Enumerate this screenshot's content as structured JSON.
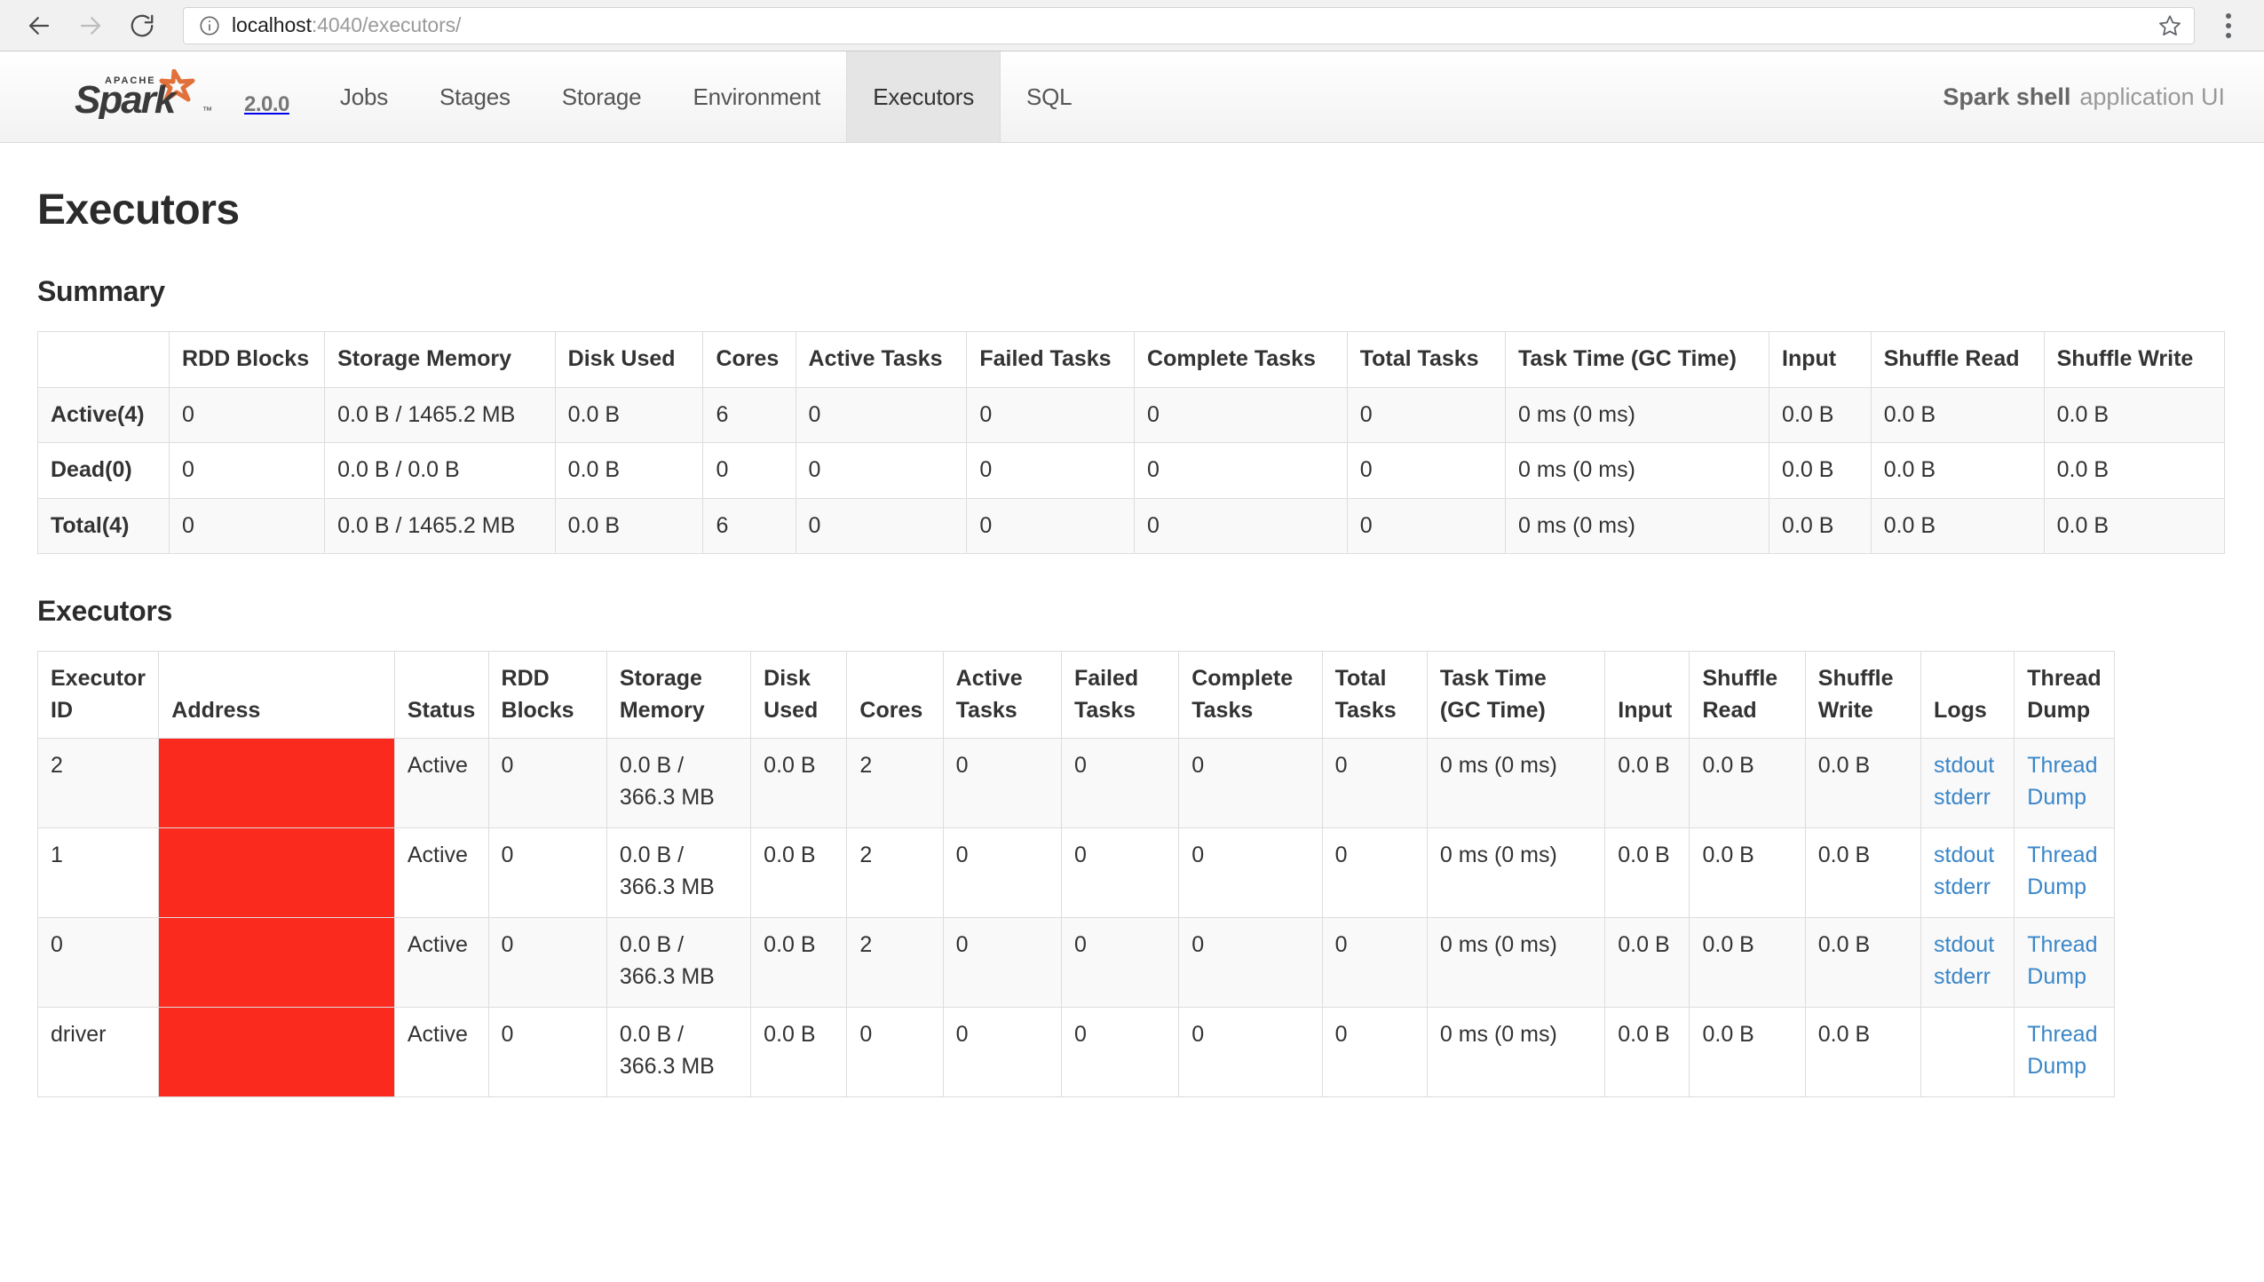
{
  "browser": {
    "back_icon": "back-arrow-icon",
    "forward_icon": "forward-arrow-icon",
    "reload_icon": "reload-icon",
    "info_icon": "page-info-icon",
    "url_host": "localhost",
    "url_rest": ":4040/executors/",
    "url_full": "localhost:4040/executors/",
    "bookmark_icon": "star-icon",
    "menu_icon": "three-dot-menu-icon"
  },
  "navbar": {
    "logo_alt": "Apache Spark",
    "version": "2.0.0",
    "tabs": [
      {
        "label": "Jobs",
        "active": false
      },
      {
        "label": "Stages",
        "active": false
      },
      {
        "label": "Storage",
        "active": false
      },
      {
        "label": "Environment",
        "active": false
      },
      {
        "label": "Executors",
        "active": true
      },
      {
        "label": "SQL",
        "active": false
      }
    ],
    "app_name": "Spark shell",
    "app_suffix": "application UI"
  },
  "page": {
    "title": "Executors",
    "summary_heading": "Summary",
    "executors_heading": "Executors"
  },
  "summary": {
    "headers": [
      "",
      "RDD Blocks",
      "Storage Memory",
      "Disk Used",
      "Cores",
      "Active Tasks",
      "Failed Tasks",
      "Complete Tasks",
      "Total Tasks",
      "Task Time (GC Time)",
      "Input",
      "Shuffle Read",
      "Shuffle Write"
    ],
    "rows": [
      {
        "label": "Active(4)",
        "rdd_blocks": "0",
        "storage_memory": "0.0 B / 1465.2 MB",
        "disk_used": "0.0 B",
        "cores": "6",
        "active_tasks": "0",
        "failed_tasks": "0",
        "complete_tasks": "0",
        "total_tasks": "0",
        "task_time": "0 ms (0 ms)",
        "input": "0.0 B",
        "shuffle_read": "0.0 B",
        "shuffle_write": "0.0 B"
      },
      {
        "label": "Dead(0)",
        "rdd_blocks": "0",
        "storage_memory": "0.0 B / 0.0 B",
        "disk_used": "0.0 B",
        "cores": "0",
        "active_tasks": "0",
        "failed_tasks": "0",
        "complete_tasks": "0",
        "total_tasks": "0",
        "task_time": "0 ms (0 ms)",
        "input": "0.0 B",
        "shuffle_read": "0.0 B",
        "shuffle_write": "0.0 B"
      },
      {
        "label": "Total(4)",
        "rdd_blocks": "0",
        "storage_memory": "0.0 B / 1465.2 MB",
        "disk_used": "0.0 B",
        "cores": "6",
        "active_tasks": "0",
        "failed_tasks": "0",
        "complete_tasks": "0",
        "total_tasks": "0",
        "task_time": "0 ms (0 ms)",
        "input": "0.0 B",
        "shuffle_read": "0.0 B",
        "shuffle_write": "0.0 B"
      }
    ]
  },
  "executors": {
    "headers": [
      "Executor ID",
      "Address",
      "Status",
      "RDD Blocks",
      "Storage Memory",
      "Disk Used",
      "Cores",
      "Active Tasks",
      "Failed Tasks",
      "Complete Tasks",
      "Total Tasks",
      "Task Time (GC Time)",
      "Input",
      "Shuffle Read",
      "Shuffle Write",
      "Logs",
      "Thread Dump"
    ],
    "address_redacted": true,
    "redaction_color": "#fa2a1e",
    "rows": [
      {
        "executor_id": "2",
        "address": "",
        "status": "Active",
        "rdd_blocks": "0",
        "storage_memory": "0.0 B / 366.3 MB",
        "disk_used": "0.0 B",
        "cores": "2",
        "active_tasks": "0",
        "failed_tasks": "0",
        "complete_tasks": "0",
        "total_tasks": "0",
        "task_time": "0 ms (0 ms)",
        "input": "0.0 B",
        "shuffle_read": "0.0 B",
        "shuffle_write": "0.0 B",
        "log_stdout": "stdout",
        "log_stderr": "stderr",
        "thread_dump": "Thread Dump"
      },
      {
        "executor_id": "1",
        "address": "",
        "status": "Active",
        "rdd_blocks": "0",
        "storage_memory": "0.0 B / 366.3 MB",
        "disk_used": "0.0 B",
        "cores": "2",
        "active_tasks": "0",
        "failed_tasks": "0",
        "complete_tasks": "0",
        "total_tasks": "0",
        "task_time": "0 ms (0 ms)",
        "input": "0.0 B",
        "shuffle_read": "0.0 B",
        "shuffle_write": "0.0 B",
        "log_stdout": "stdout",
        "log_stderr": "stderr",
        "thread_dump": "Thread Dump"
      },
      {
        "executor_id": "0",
        "address": "",
        "status": "Active",
        "rdd_blocks": "0",
        "storage_memory": "0.0 B / 366.3 MB",
        "disk_used": "0.0 B",
        "cores": "2",
        "active_tasks": "0",
        "failed_tasks": "0",
        "complete_tasks": "0",
        "total_tasks": "0",
        "task_time": "0 ms (0 ms)",
        "input": "0.0 B",
        "shuffle_read": "0.0 B",
        "shuffle_write": "0.0 B",
        "log_stdout": "stdout",
        "log_stderr": "stderr",
        "thread_dump": "Thread Dump"
      },
      {
        "executor_id": "driver",
        "address": "",
        "status": "Active",
        "rdd_blocks": "0",
        "storage_memory": "0.0 B / 366.3 MB",
        "disk_used": "0.0 B",
        "cores": "0",
        "active_tasks": "0",
        "failed_tasks": "0",
        "complete_tasks": "0",
        "total_tasks": "0",
        "task_time": "0 ms (0 ms)",
        "input": "0.0 B",
        "shuffle_read": "0.0 B",
        "shuffle_write": "0.0 B",
        "log_stdout": "",
        "log_stderr": "",
        "thread_dump": "Thread Dump"
      }
    ]
  }
}
